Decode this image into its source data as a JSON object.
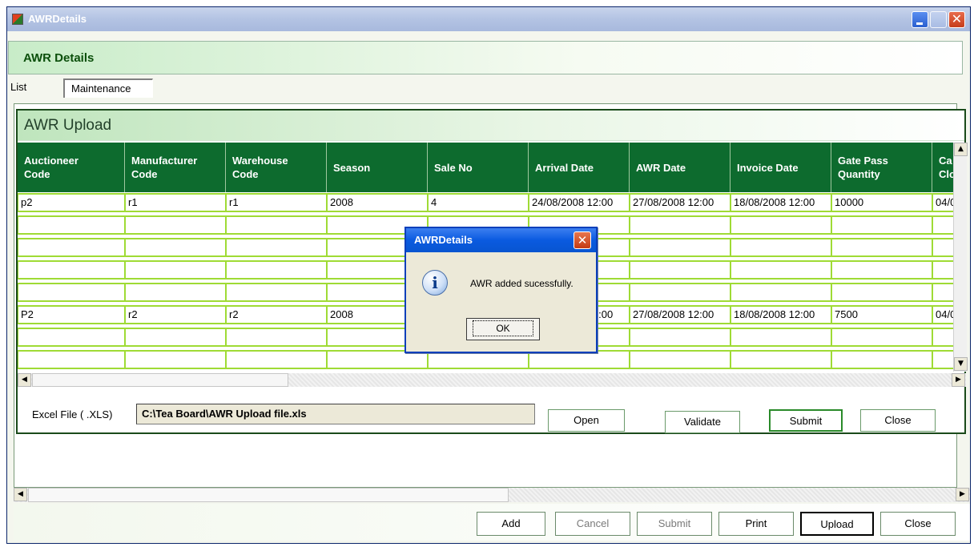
{
  "window": {
    "title": "AWRDetails"
  },
  "header": {
    "title": "AWR Details"
  },
  "tabs": [
    {
      "label": "List"
    },
    {
      "label": "Maintenance"
    }
  ],
  "upload": {
    "title": "AWR Upload",
    "columns": [
      {
        "line1": "Auctioneer",
        "line2": "Code"
      },
      {
        "line1": "Manufacturer",
        "line2": "Code"
      },
      {
        "line1": "Warehouse",
        "line2": "Code"
      },
      {
        "line1": "Season",
        "line2": ""
      },
      {
        "line1": "Sale No",
        "line2": ""
      },
      {
        "line1": "Arrival Date",
        "line2": ""
      },
      {
        "line1": "AWR Date",
        "line2": ""
      },
      {
        "line1": "Invoice Date",
        "line2": ""
      },
      {
        "line1": "Gate Pass",
        "line2": "Quantity"
      },
      {
        "line1": "Ca",
        "line2": "Clo"
      }
    ],
    "rows": [
      [
        "p2",
        "r1",
        "r1",
        "2008",
        "4",
        "24/08/2008 12:00",
        "27/08/2008 12:00",
        "18/08/2008 12:00",
        "10000",
        "04/0"
      ],
      [
        "",
        "",
        "",
        "",
        "",
        "",
        "",
        "",
        "",
        ""
      ],
      [
        "",
        "",
        "",
        "",
        "",
        "",
        "",
        "",
        "",
        ""
      ],
      [
        "",
        "",
        "",
        "",
        "",
        "",
        "",
        "",
        "",
        ""
      ],
      [
        "",
        "",
        "",
        "",
        "",
        "",
        "",
        "",
        "",
        ""
      ],
      [
        "P2",
        "r2",
        "r2",
        "2008",
        "",
        "24/08/2008 12:00",
        "27/08/2008 12:00",
        "18/08/2008 12:00",
        "7500",
        "04/0"
      ],
      [
        "",
        "",
        "",
        "",
        "",
        "",
        "",
        "",
        "",
        ""
      ],
      [
        "",
        "",
        "",
        "",
        "",
        "",
        "",
        "",
        "",
        ""
      ]
    ],
    "excel_label": "Excel File ( .XLS)",
    "excel_path": "C:\\Tea Board\\AWR Upload file.xls",
    "buttons": {
      "open": "Open",
      "validate": "Validate",
      "submit": "Submit",
      "close": "Close"
    }
  },
  "bottom_buttons": {
    "add": "Add",
    "cancel": "Cancel",
    "submit": "Submit",
    "print": "Print",
    "upload": "Upload",
    "close": "Close"
  },
  "dialog": {
    "title": "AWRDetails",
    "message": "AWR added sucessfully.",
    "ok": "OK",
    "close_glyph": "✕",
    "icon_glyph": "i"
  },
  "icons": {
    "scroll_up": "scroll-up-arrow-icon",
    "scroll_down": "scroll-down-arrow-icon",
    "scroll_left": "scroll-left-arrow-icon",
    "scroll_right": "scroll-right-arrow-icon",
    "info": "info-icon"
  },
  "glyphs": {
    "up": "▲",
    "down": "▼",
    "left": "◀",
    "right": "▶",
    "close": "✕"
  }
}
